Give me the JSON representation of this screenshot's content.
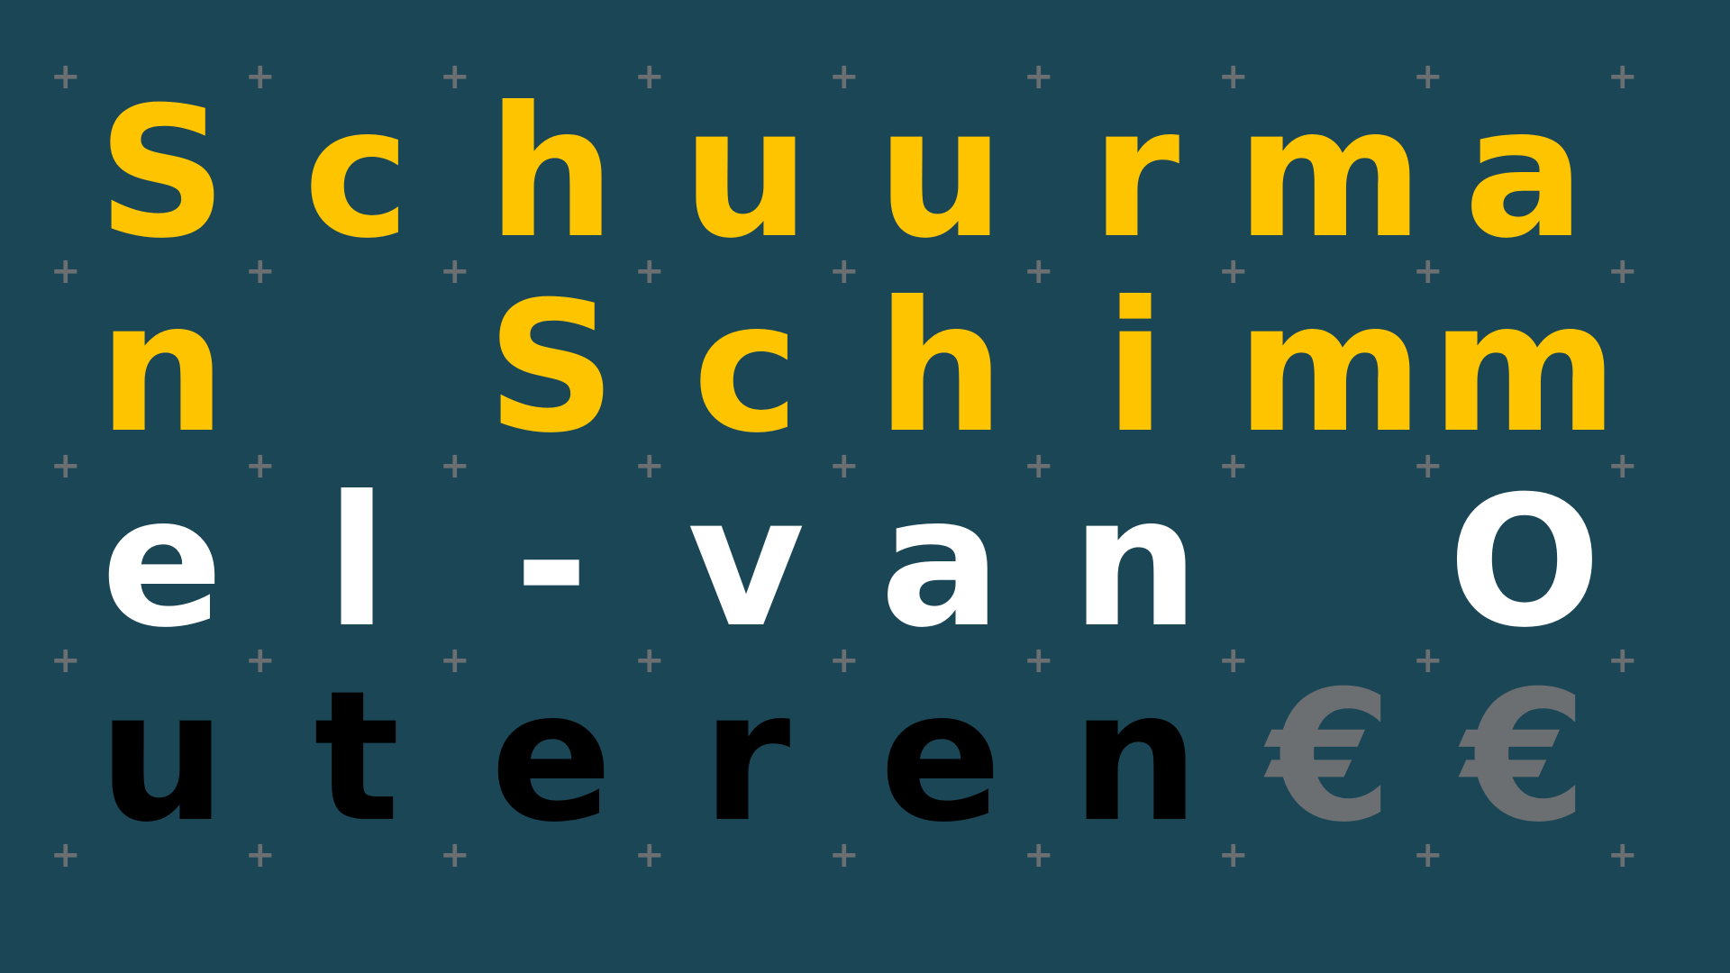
{
  "background_color": "#1a4656",
  "grid_marker": {
    "glyph": "+",
    "color": "#6b6f72"
  },
  "rows": [
    {
      "color": "#fec400",
      "cells": [
        "S",
        "c",
        "h",
        "u",
        "u",
        "r",
        "m",
        "a"
      ]
    },
    {
      "color": "#fec400",
      "cells": [
        "n",
        "",
        "S",
        "c",
        "h",
        "i",
        "m",
        "m"
      ]
    },
    {
      "color": "#ffffff",
      "cells": [
        "e",
        "l",
        "-",
        "v",
        "a",
        "n",
        "",
        "O"
      ]
    },
    {
      "color": "#000000",
      "cells": [
        "u",
        "t",
        "e",
        "r",
        "e",
        "n",
        "€",
        "€"
      ],
      "accent_from": 6,
      "accent_color": "#6b6f72"
    }
  ]
}
